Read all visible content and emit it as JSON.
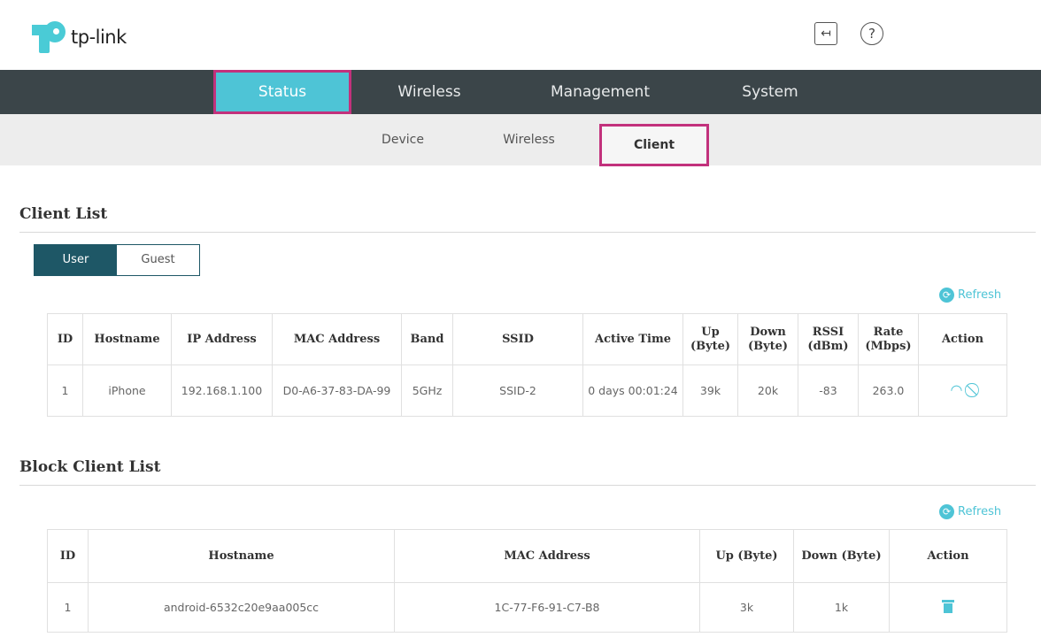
{
  "brand": {
    "logo_text": "tp-link",
    "accent": "#4ec4d6",
    "highlight": "#c2317c",
    "nav_bg": "#3b4549"
  },
  "header": {
    "icons": [
      "logout-icon",
      "help-icon"
    ]
  },
  "main_nav": {
    "items": [
      "Status",
      "Wireless",
      "Management",
      "System"
    ],
    "active": "Status"
  },
  "sub_nav": {
    "items": [
      "Device",
      "Wireless",
      "Client"
    ],
    "active": "Client"
  },
  "client_list": {
    "title": "Client List",
    "toggle": {
      "user": "User",
      "guest": "Guest",
      "selected": "User"
    },
    "refresh": "Refresh",
    "columns": [
      "ID",
      "Hostname",
      "IP Address",
      "MAC Address",
      "Band",
      "SSID",
      "Active Time",
      "Up (Byte)",
      "Down (Byte)",
      "RSSI (dBm)",
      "Rate (Mbps)",
      "Action"
    ],
    "rows": [
      {
        "id": "1",
        "hostname": "iPhone",
        "ip": "192.168.1.100",
        "mac": "D0-A6-37-83-DA-99",
        "band": "5GHz",
        "ssid": "SSID-2",
        "active_time": "0 days 00:01:24",
        "up": "39k",
        "down": "20k",
        "rssi": "-83",
        "rate": "263.0",
        "actions": [
          "speed-limit-icon",
          "block-icon"
        ]
      }
    ]
  },
  "block_client_list": {
    "title": "Block Client List",
    "refresh": "Refresh",
    "columns": [
      "ID",
      "Hostname",
      "MAC Address",
      "Up (Byte)",
      "Down (Byte)",
      "Action"
    ],
    "rows": [
      {
        "id": "1",
        "hostname": "android-6532c20e9aa005cc",
        "mac": "1C-77-F6-91-C7-B8",
        "up": "3k",
        "down": "1k",
        "actions": [
          "trash-icon"
        ]
      }
    ]
  }
}
